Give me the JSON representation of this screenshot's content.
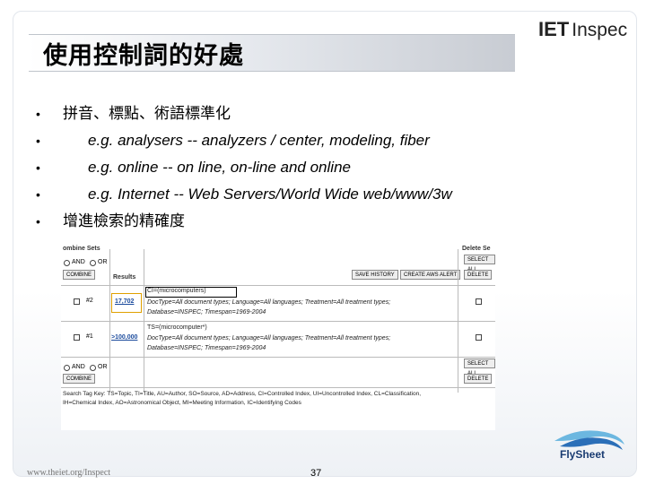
{
  "slide": {
    "title": "使用控制詞的好處",
    "logo_brand": "IET",
    "logo_product": "Inspec",
    "bullets": [
      {
        "text": "拼音、標點、術語標準化",
        "indent": false
      },
      {
        "text": "e.g. analysers -- analyzers / center, modeling, fiber",
        "indent": true
      },
      {
        "text": "e.g. online -- on line, on-line and online",
        "indent": true
      },
      {
        "text": "e.g. Internet -- Web Servers/World Wide web/www/3w",
        "indent": true
      },
      {
        "text": "增進檢索的精確度",
        "indent": false
      }
    ],
    "footer_url": "www.theiet.org/Inspect",
    "page_number": "37",
    "flysheet_label": "FlySheet"
  },
  "screenshot": {
    "combine_sets_header": "ombine Sets",
    "results_header": "Results",
    "delete_sets_header": "Delete Se",
    "and_label": "AND",
    "or_label": "OR",
    "combine_button": "COMBINE",
    "save_history_button": "SAVE HISTORY",
    "create_alert_button": "CREATE AWS ALERT",
    "select_all_button": "SELECT ALL",
    "delete_button": "DELETE",
    "rows": [
      {
        "set": "#2",
        "results": "17,702",
        "query": "CI=(microcomputers)",
        "detail1": "DocType=All document types; Language=All languages; Treatment=All treatment types;",
        "detail2": "Database=INSPEC; Timespan=1969-2004"
      },
      {
        "set": "#1",
        "results": ">100,000",
        "query": "TS=(microcomputer*)",
        "detail1": "DocType=All document types; Language=All languages; Treatment=All treatment types;",
        "detail2": "Database=INSPEC; Timespan=1969-2004"
      }
    ],
    "search_key_line1": "Search Tag Key: TS=Topic, TI=Title, AU=Author, SO=Source, AD=Address, CI=Controlled Index, UI=Uncontrolled Index, CL=Classification,",
    "search_key_line2": "IH=Chemical Index, AO=Astronomical Object, MI=Meeting Information, IC=Identifying Codes"
  }
}
